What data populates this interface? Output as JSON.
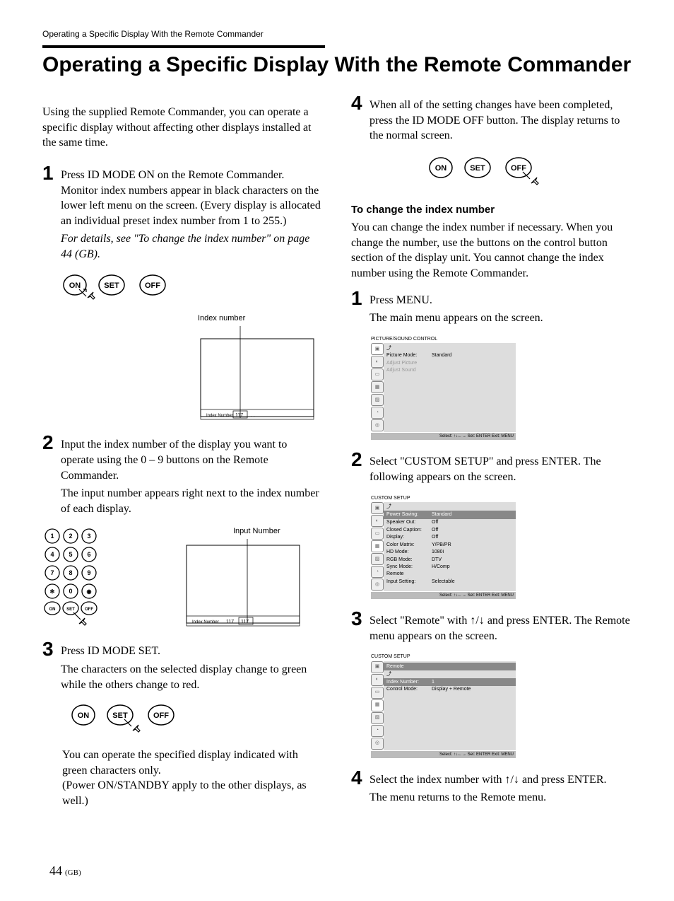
{
  "header": "Operating a Specific Display With the Remote Commander",
  "title": "Operating a Specific Display With the Remote Commander",
  "intro": "Using the supplied Remote Commander, you can operate a specific display without affecting other displays installed at the same time.",
  "left_steps": {
    "s1": {
      "text": "Press ID MODE ON on the Remote Commander. Monitor index numbers appear in black characters on the lower left menu on the screen. (Every display is allocated an individual preset index number from 1 to 255.)",
      "italic": "For details, see \"To change the index number\" on page 44 (GB).",
      "label_index_number": "Index number",
      "screen_label": "Index Number",
      "screen_val": "117",
      "screen_dots": ". ."
    },
    "s2": {
      "text": "Input the index number of the display you want to operate using the 0 – 9 buttons on the Remote Commander.",
      "text2": "The input number appears right next to the index number of each display.",
      "label_input_number": "Input Number",
      "screen_label": "Index Number",
      "screen_val1": "117",
      "screen_val2": "117"
    },
    "s3": {
      "text": "Press ID MODE SET.",
      "text2": "The characters on the selected display change to green while the others change to red.",
      "text3": "You can operate the specified display indicated with green characters only.",
      "text4": "(Power ON/STANDBY apply to the other displays, as well.)"
    }
  },
  "right_steps": {
    "s4": {
      "text": "When all of the setting changes have been completed, press the ID MODE OFF button. The display returns to the normal screen."
    },
    "change_heading": "To change the index number",
    "change_intro": "You can change the index number if necessary. When you change the number, use the buttons on the control button section of the display unit. You cannot change the index number using the Remote Commander.",
    "c1": {
      "text": "Press MENU.",
      "text2": "The main menu appears on the screen.",
      "menu_title": "PICTURE/SOUND CONTROL",
      "rows": [
        {
          "label": "Picture Mode:",
          "val": "Standard"
        },
        {
          "label": "Adjust Picture",
          "val": ""
        },
        {
          "label": "Adjust Sound",
          "val": ""
        }
      ]
    },
    "c2": {
      "text": "Select \"CUSTOM SETUP\" and press ENTER. The following appears on the screen.",
      "menu_title": "CUSTOM SETUP",
      "hilite": "Power Saving:",
      "hilite_val": "Standard",
      "rows": [
        {
          "label": "Speaker Out:",
          "val": "Off"
        },
        {
          "label": "Closed Caption:",
          "val": "Off"
        },
        {
          "label": "Display:",
          "val": "Off"
        },
        {
          "label": "Color Matrix:",
          "val": "Y/PB/PR"
        },
        {
          "label": "HD Mode:",
          "val": "1080i"
        },
        {
          "label": "RGB Mode:",
          "val": "DTV"
        },
        {
          "label": "Sync Mode:",
          "val": "H/Comp"
        },
        {
          "label": "Remote",
          "val": ""
        },
        {
          "label": "Input Setting:",
          "val": "Selectable"
        }
      ]
    },
    "c3": {
      "text": "Select \"Remote\" with ↑/↓ and press ENTER. The Remote menu appears on the screen.",
      "menu_title": "CUSTOM SETUP",
      "hilite_top": "Remote",
      "hilite": "Index Number:",
      "hilite_val": "1",
      "rows": [
        {
          "label": "Control Mode:",
          "val": "Display + Remote"
        }
      ]
    },
    "c4": {
      "text": "Select the index number with ↑/↓ and press ENTER.",
      "text2": "The menu returns to the Remote menu."
    },
    "menu_foot": "Select: ↑↓←→   Set: ENTER   Exit: MENU"
  },
  "buttons": {
    "on": "ON",
    "set": "SET",
    "off": "OFF"
  },
  "keypad": [
    "1",
    "2",
    "3",
    "4",
    "5",
    "6",
    "7",
    "8",
    "9",
    "",
    "0",
    ""
  ],
  "keypad_row4": [
    "ON",
    "SET",
    "OFF"
  ],
  "footer_num": "44",
  "footer_suffix": "(GB)"
}
